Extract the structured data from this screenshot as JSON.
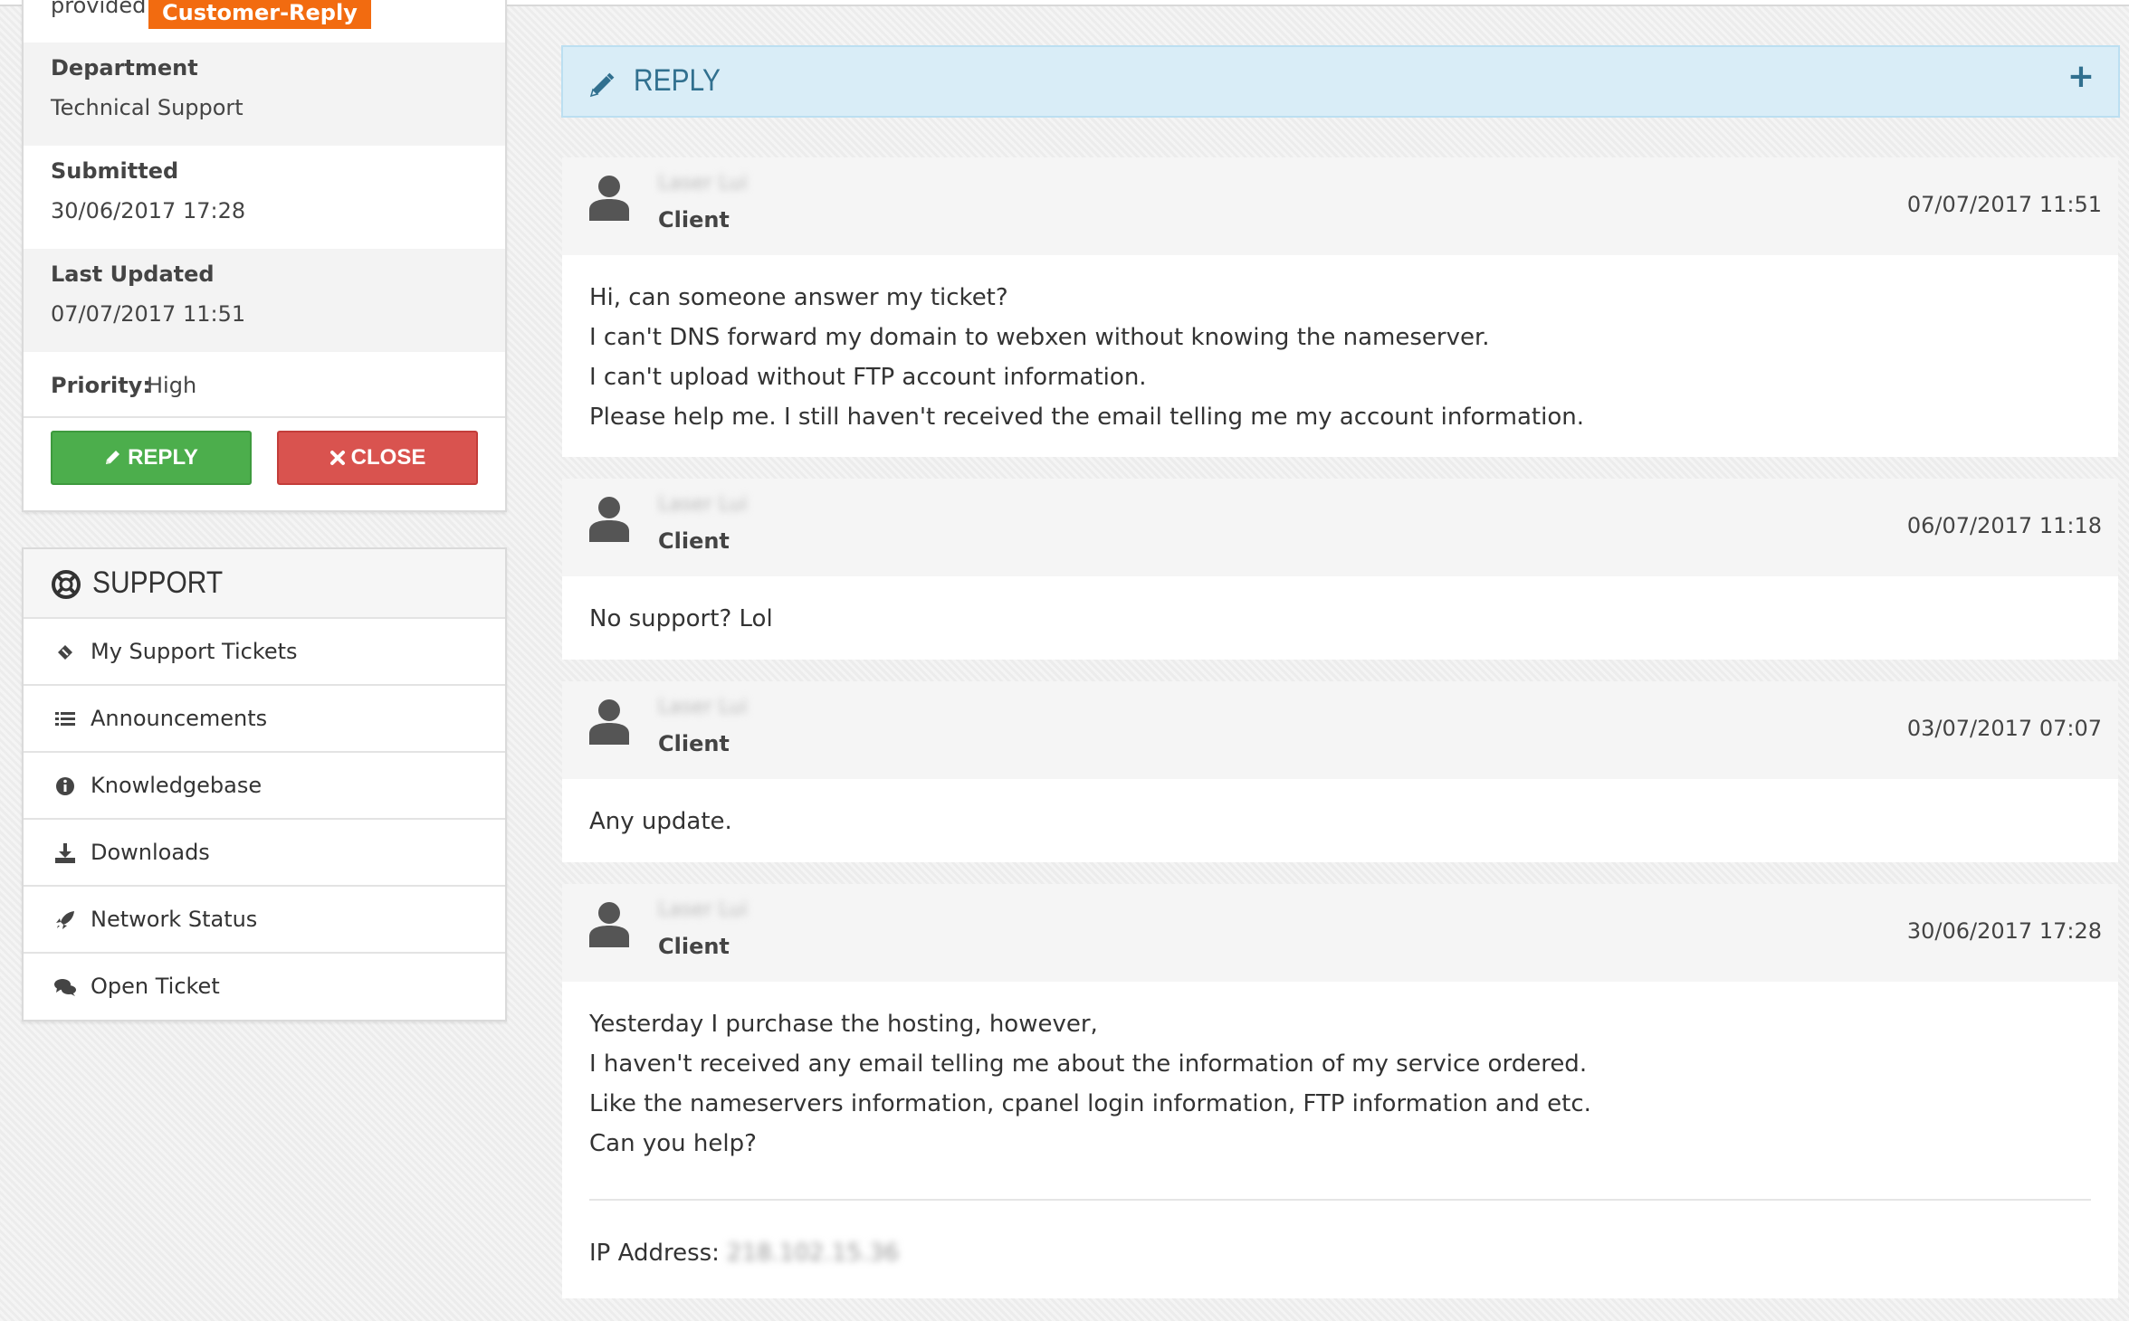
{
  "ticket_info": {
    "status_prefix": "provided",
    "status_badge": "Customer-Reply",
    "department_label": "Department",
    "department_value": "Technical Support",
    "submitted_label": "Submitted",
    "submitted_value": "30/06/2017 17:28",
    "last_updated_label": "Last Updated",
    "last_updated_value": "07/07/2017 11:51",
    "priority_label": "Priority:",
    "priority_value": "High",
    "reply_button": "REPLY",
    "close_button": "CLOSE"
  },
  "support": {
    "title": "SUPPORT",
    "items": [
      {
        "label": "My Support Tickets",
        "icon": "ticket-icon"
      },
      {
        "label": "Announcements",
        "icon": "list-icon"
      },
      {
        "label": "Knowledgebase",
        "icon": "info-circle-icon"
      },
      {
        "label": "Downloads",
        "icon": "download-icon"
      },
      {
        "label": "Network Status",
        "icon": "rocket-icon"
      },
      {
        "label": "Open Ticket",
        "icon": "comments-icon"
      }
    ]
  },
  "reply_panel": {
    "title": "REPLY",
    "expand": "+"
  },
  "messages": [
    {
      "author": "Laser Lui",
      "role": "Client",
      "date": "07/07/2017 11:51",
      "lines": [
        "Hi, can someone answer my ticket?",
        "I can't DNS forward my domain to webxen without knowing the nameserver.",
        "I can't upload without FTP account information.",
        "Please help me. I still haven't received the email telling me my account information."
      ]
    },
    {
      "author": "Laser Lui",
      "role": "Client",
      "date": "06/07/2017 11:18",
      "lines": [
        "No support? Lol"
      ]
    },
    {
      "author": "Laser Lui",
      "role": "Client",
      "date": "03/07/2017 07:07",
      "lines": [
        "Any update."
      ]
    },
    {
      "author": "Laser Lui",
      "role": "Client",
      "date": "30/06/2017 17:28",
      "lines": [
        "Yesterday I purchase the hosting, however,",
        "I haven't received any email telling me about the information of my service ordered.",
        "Like the nameservers information, cpanel login information, FTP information and etc.",
        "Can you help?"
      ],
      "ip_label": "IP Address:",
      "ip_value": "218.102.15.36"
    }
  ],
  "colors": {
    "badge": "#f26b10",
    "reply_button": "#4cae4c",
    "close_button": "#d9534f",
    "reply_panel_bg": "#d9edf7",
    "reply_panel_text": "#31708f"
  }
}
